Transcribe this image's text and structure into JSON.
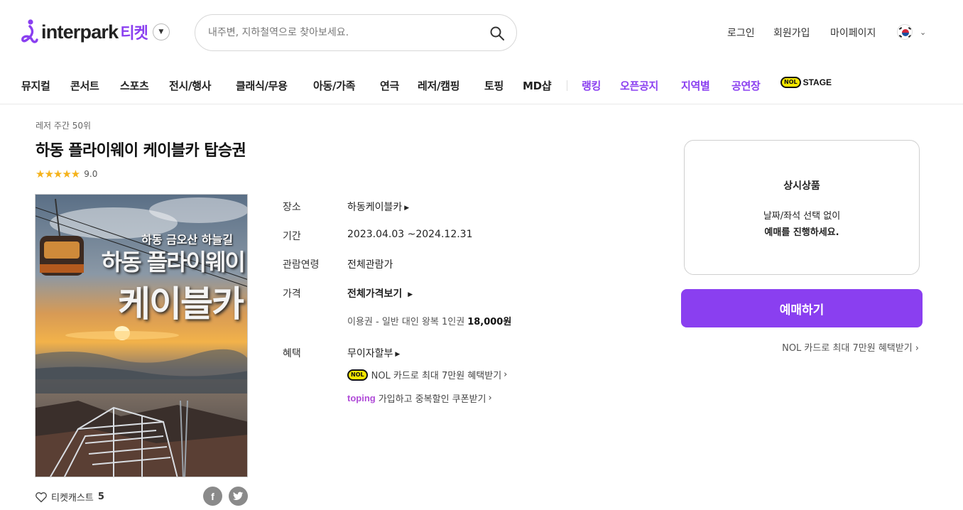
{
  "header": {
    "logo_text": "interpark",
    "logo_ticket": "티켓",
    "search_placeholder": "내주변, 지하철역으로 찾아보세요.",
    "links": [
      "로그인",
      "회원가입",
      "마이페이지"
    ]
  },
  "nav": {
    "items": [
      "뮤지컬",
      "콘서트",
      "스포츠",
      "전시/행사",
      "클래식/무용",
      "아동/가족",
      "연극",
      "레저/캠핑",
      "토핑",
      "MD샵"
    ],
    "highlight_items": [
      "랭킹",
      "오픈공지",
      "지역별",
      "공연장"
    ],
    "stage_badge": "NOL",
    "stage_label": "STAGE"
  },
  "product": {
    "breadcrumb": "레저 주간 50위",
    "title": "하동 플라이웨이 케이블카 탑승권",
    "stars": "★★★★★",
    "rating": "9.0",
    "poster_subtitle": "하동 금오산 하늘길",
    "poster_title_1": "하동 플라이웨이",
    "poster_title_2": "케이블카",
    "info": {
      "place_label": "장소",
      "place_value": "하동케이블카",
      "period_label": "기간",
      "period_value": "2023.04.03 ~2024.12.31",
      "age_label": "관람연령",
      "age_value": "전체관람가",
      "price_label": "가격",
      "price_value": "전체가격보기",
      "price_item": "이용권 - 일반 대인 왕복 1인권",
      "price_amount": "18,000원",
      "benefit_label": "혜택",
      "benefit_value": "무이자할부",
      "benefit_nol_badge": "NOL",
      "benefit_nol": "NOL 카드로 최대 7만원 혜택받기",
      "benefit_toping_logo": "toping",
      "benefit_toping": "가입하고 중복할인 쿠폰받기"
    },
    "castcount_label": "티켓캐스트",
    "castcount": "5"
  },
  "booking": {
    "box_title": "상시상품",
    "box_line1": "날짜/좌석 선택 없이",
    "box_line2": "예매를 진행하세요.",
    "button": "예매하기",
    "nol_card": "NOL 카드로 최대 7만원 혜택받기 ›"
  },
  "colors": {
    "accent": "#8a3ff0",
    "star": "#f5b21a"
  }
}
